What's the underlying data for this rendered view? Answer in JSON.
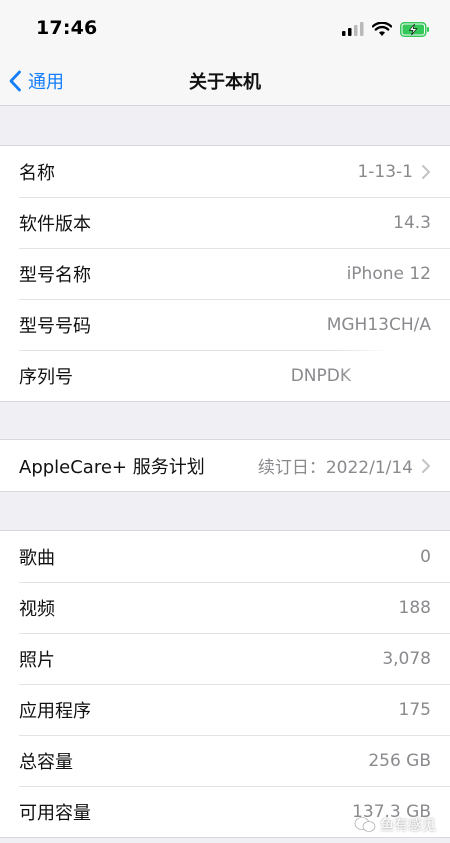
{
  "status_bar": {
    "time": "17:46"
  },
  "nav": {
    "back_label": "通用",
    "title": "关于本机"
  },
  "groups": [
    {
      "rows": [
        {
          "label": "名称",
          "value": "1-13-1"
        },
        {
          "label": "软件版本",
          "value": "14.3"
        },
        {
          "label": "型号名称",
          "value": "iPhone 12"
        },
        {
          "label": "型号号码",
          "value": "MGH13CH/A"
        },
        {
          "label": "序列号",
          "value": "DNPDK"
        }
      ]
    },
    {
      "rows": [
        {
          "label": "AppleCare+ 服务计划",
          "value": "续订日：2022/1/14"
        }
      ]
    },
    {
      "rows": [
        {
          "label": "歌曲",
          "value": "0"
        },
        {
          "label": "视频",
          "value": "188"
        },
        {
          "label": "照片",
          "value": "3,078"
        },
        {
          "label": "应用程序",
          "value": "175"
        },
        {
          "label": "总容量",
          "value": "256 GB"
        },
        {
          "label": "可用容量",
          "value": "137.3 GB"
        }
      ]
    }
  ],
  "watermark": {
    "text": "鱼有感见"
  },
  "colors": {
    "accent": "#147efb",
    "background": "#efeff4",
    "value_gray": "#8a8a8e",
    "battery_green": "#34c759"
  }
}
